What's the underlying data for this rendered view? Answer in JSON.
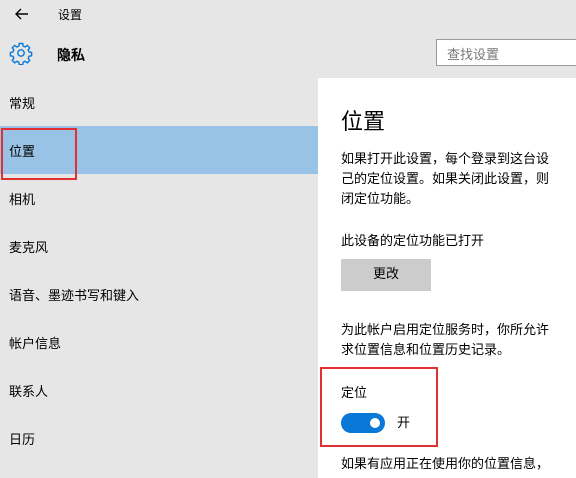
{
  "window": {
    "title": "设置"
  },
  "header": {
    "title": "隐私",
    "search_placeholder": "查找设置"
  },
  "sidebar": {
    "items": [
      {
        "label": "常规"
      },
      {
        "label": "位置"
      },
      {
        "label": "相机"
      },
      {
        "label": "麦克风"
      },
      {
        "label": "语音、墨迹书写和键入"
      },
      {
        "label": "帐户信息"
      },
      {
        "label": "联系人"
      },
      {
        "label": "日历"
      }
    ],
    "selected": "位置"
  },
  "content": {
    "title": "位置",
    "intro_lines": [
      "如果打开此设置，每个登录到这台设",
      "己的定位设置。如果关闭此设置，则",
      "闭定位功能。"
    ],
    "device_status": "此设备的定位功能已打开",
    "change_button": "更改",
    "account_lines": [
      "为此帐户启用定位服务时，你所允许",
      "求位置信息和位置历史记录。"
    ],
    "location_label": "定位",
    "toggle_state": "开",
    "bottom_line": "如果有应用正在使用你的位置信息，"
  },
  "colors": {
    "accent": "#0a78d7",
    "selected_bg": "#99c3e6",
    "highlight": "#e03030",
    "sidebar_bg": "#e6e6e6"
  }
}
